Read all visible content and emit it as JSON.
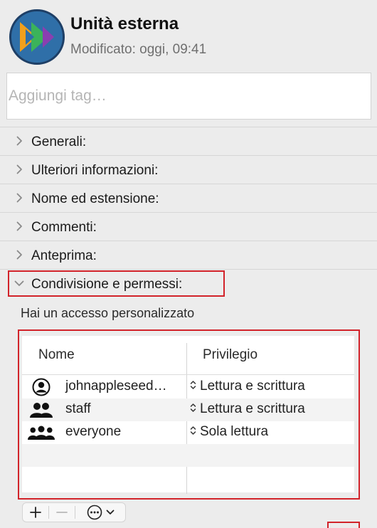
{
  "header": {
    "title": "Unità esterna",
    "modified": "Modificato: oggi, 09:41",
    "icon": "external-drive-icon"
  },
  "tags": {
    "placeholder": "Aggiungi tag…",
    "value": ""
  },
  "sections": [
    {
      "label": "Generali:",
      "expanded": false
    },
    {
      "label": "Ulteriori informazioni:",
      "expanded": false
    },
    {
      "label": "Nome ed estensione:",
      "expanded": false
    },
    {
      "label": "Commenti:",
      "expanded": false
    },
    {
      "label": "Anteprima:",
      "expanded": false
    },
    {
      "label": "Condivisione e permessi:",
      "expanded": true
    }
  ],
  "sharing": {
    "access_text": "Hai un accesso personalizzato",
    "columns": {
      "name": "Nome",
      "privilege": "Privilegio"
    },
    "rows": [
      {
        "icon": "user-icon",
        "name": "johnappleseed…",
        "privilege": "Lettura e scrittura"
      },
      {
        "icon": "group-icon",
        "name": "staff",
        "privilege": "Lettura e scrittura"
      },
      {
        "icon": "everyone-icon",
        "name": "everyone",
        "privilege": "Sola lettura"
      }
    ],
    "toolbar": {
      "add": "+",
      "remove": "−"
    }
  },
  "colors": {
    "highlight": "#d2232a",
    "icon_blue": "#2f6fa8"
  }
}
